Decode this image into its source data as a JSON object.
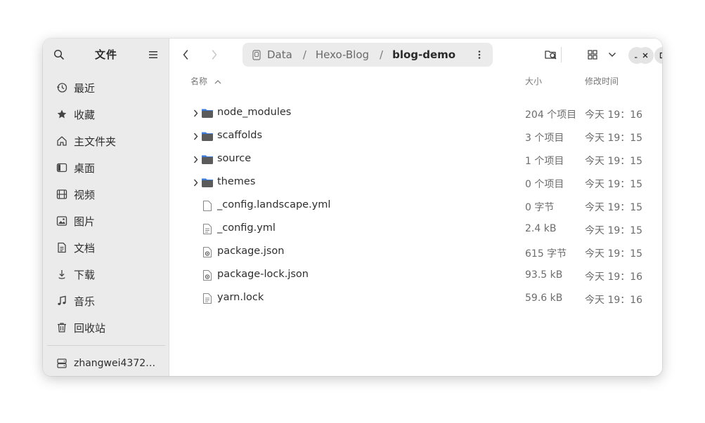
{
  "sidebar": {
    "title": "文件",
    "items": [
      {
        "label": "最近",
        "icon": "clock-icon"
      },
      {
        "label": "收藏",
        "icon": "star-icon"
      },
      {
        "label": "主文件夹",
        "icon": "home-icon"
      },
      {
        "label": "桌面",
        "icon": "desktop-icon"
      },
      {
        "label": "视频",
        "icon": "film-icon"
      },
      {
        "label": "图片",
        "icon": "image-icon"
      },
      {
        "label": "文档",
        "icon": "document-icon"
      },
      {
        "label": "下载",
        "icon": "download-icon"
      },
      {
        "label": "音乐",
        "icon": "music-icon"
      },
      {
        "label": "回收站",
        "icon": "trash-icon"
      }
    ],
    "network_drive": {
      "label": "zhangwei4372…",
      "icon": "network-drive-icon"
    }
  },
  "pathbar": {
    "segments": [
      "Data",
      "Hexo-Blog",
      "blog-demo"
    ],
    "separator": "/"
  },
  "columns": {
    "name": "名称",
    "size": "大小",
    "modified": "修改时间"
  },
  "files": [
    {
      "name": "node_modules",
      "size": "204 个项目",
      "modified": "今天 19：16",
      "type": "folder"
    },
    {
      "name": "scaffolds",
      "size": "3 个项目",
      "modified": "今天 19：15",
      "type": "folder"
    },
    {
      "name": "source",
      "size": "1 个项目",
      "modified": "今天 19：15",
      "type": "folder"
    },
    {
      "name": "themes",
      "size": "0 个项目",
      "modified": "今天 19：15",
      "type": "folder"
    },
    {
      "name": "_config.landscape.yml",
      "size": "0 字节",
      "modified": "今天 19：15",
      "type": "empty-file"
    },
    {
      "name": "_config.yml",
      "size": "2.4 kB",
      "modified": "今天 19：15",
      "type": "text-file"
    },
    {
      "name": "package.json",
      "size": "615 字节",
      "modified": "今天 19：15",
      "type": "json-file"
    },
    {
      "name": "package-lock.json",
      "size": "93.5 kB",
      "modified": "今天 19：16",
      "type": "json-file"
    },
    {
      "name": "yarn.lock",
      "size": "59.6 kB",
      "modified": "今天 19：16",
      "type": "text-file"
    }
  ],
  "colors": {
    "sidebar_bg": "#ebebeb",
    "folder": "#5b5b5b",
    "folder_tab": "#3d7ad6"
  }
}
